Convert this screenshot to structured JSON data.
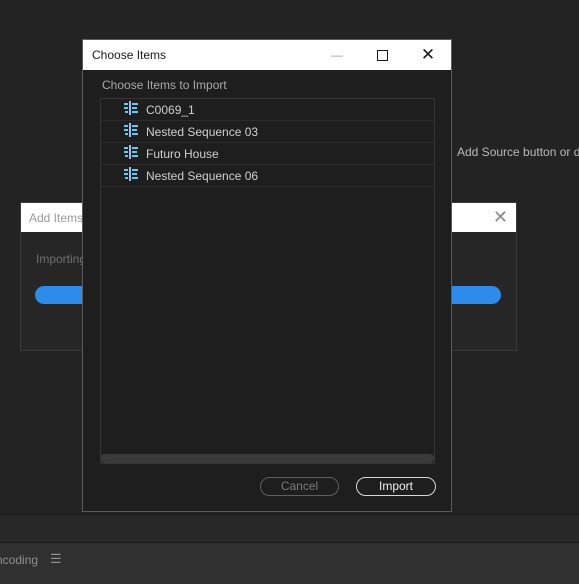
{
  "background": {
    "hint_text": "Add Source button or dra",
    "encoding_label": "ncoding",
    "menu_icon": "hamburger-menu-icon"
  },
  "add_items_dialog": {
    "title": "Add Items",
    "status": "Importing",
    "progress_percent": 100,
    "accent": "#2d8ceb"
  },
  "choose_dialog": {
    "title": "Choose Items",
    "section_label": "Choose Items to Import",
    "items": [
      {
        "label": "C0069_1",
        "icon": "sequence-icon"
      },
      {
        "label": "Nested Sequence 03",
        "icon": "sequence-icon"
      },
      {
        "label": "Futuro House",
        "icon": "sequence-icon"
      },
      {
        "label": "Nested Sequence 06",
        "icon": "sequence-icon"
      }
    ],
    "cancel_label": "Cancel",
    "import_label": "Import"
  }
}
